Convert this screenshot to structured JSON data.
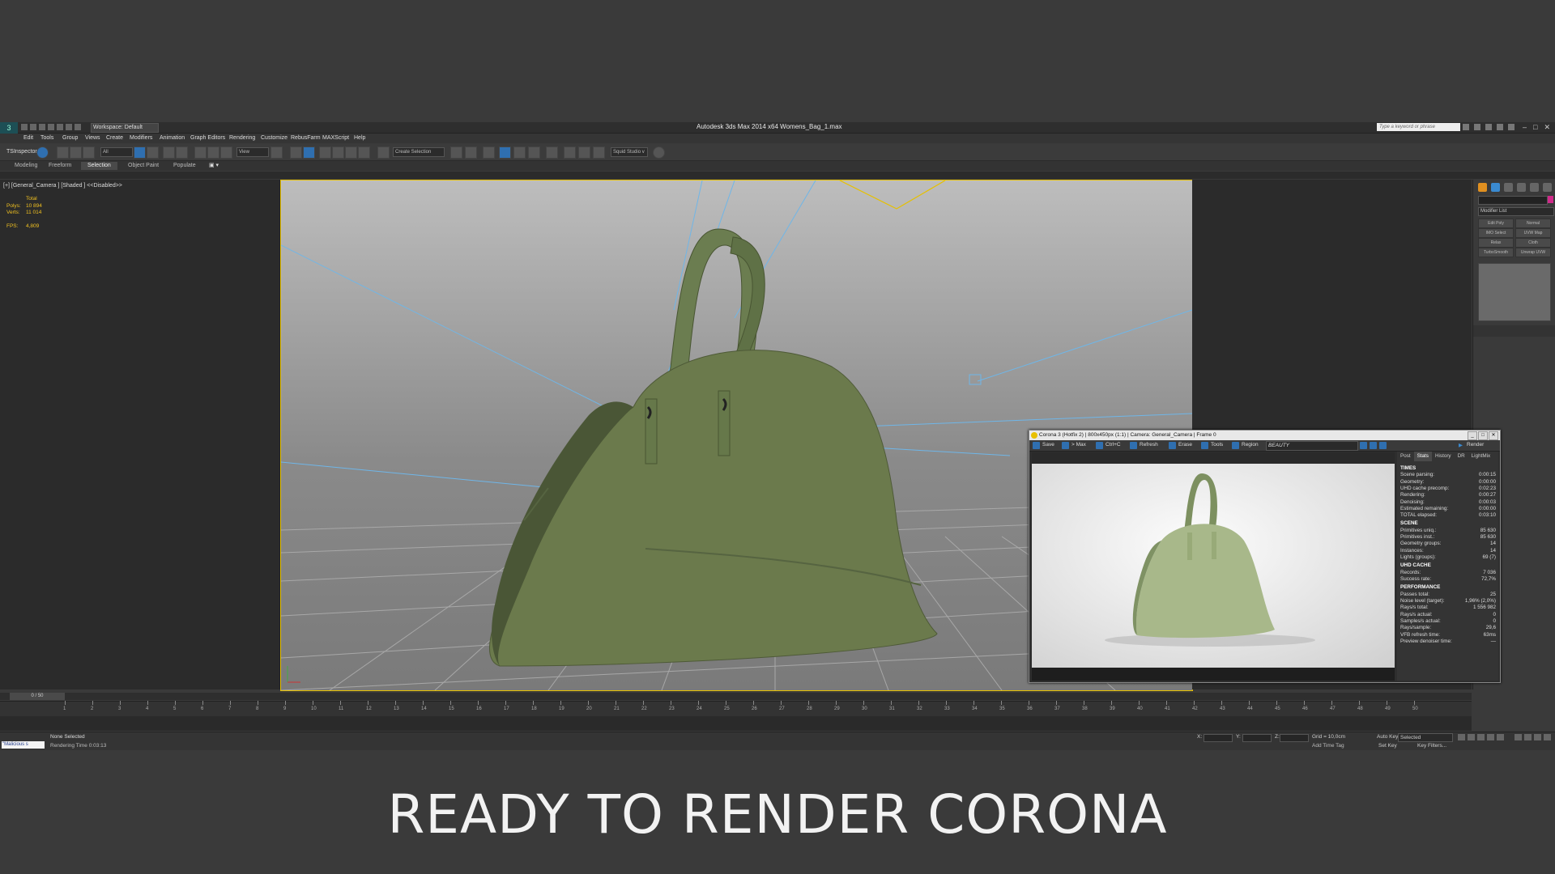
{
  "app": {
    "title": "Autodesk 3ds Max  2014 x64    Womens_Bag_1.max",
    "workspace": "Workspace: Default",
    "search_placeholder": "Type a keyword or phrase",
    "logo": "3"
  },
  "menu": [
    "Edit",
    "Tools",
    "Group",
    "Views",
    "Create",
    "Modifiers",
    "Animation",
    "Graph Editors",
    "Rendering",
    "Customize",
    "RebusFarm",
    "MAXScript",
    "Help"
  ],
  "toolbar": {
    "tsinspector": "TSInspector",
    "filter_all": "All",
    "ref_coord": "View",
    "named_selection": "Create Selection",
    "squid": "Squid Studio v"
  },
  "ribbon_tabs": [
    "Modeling",
    "Freeform",
    "Selection",
    "Object Paint",
    "Populate"
  ],
  "ribbon_active": "Selection",
  "viewport": {
    "label": "[+] [General_Camera ] [Shaded ]  <<Disabled>>",
    "stats_header": "Total",
    "polys_label": "Polys:",
    "polys": "10 894",
    "verts_label": "Verts:",
    "verts": "11 014",
    "fps_label": "FPS:",
    "fps": "4,809"
  },
  "command_panel": {
    "modifier_list": "Modifier List",
    "buttons": [
      "Edit Poly",
      "Normal",
      "IMO Select",
      "UVW Map",
      "Relax",
      "Cloth",
      "TurboSmooth",
      "Unwrap UVW"
    ]
  },
  "timeline": {
    "frame": "0 / 50",
    "ticks": [
      "1",
      "2",
      "3",
      "4",
      "5",
      "6",
      "7",
      "8",
      "9",
      "10",
      "11",
      "12",
      "13",
      "14",
      "15",
      "16",
      "17",
      "18",
      "19",
      "20",
      "21",
      "22",
      "23",
      "24",
      "25",
      "26",
      "27",
      "28",
      "29",
      "30",
      "31",
      "32",
      "33",
      "34",
      "35",
      "36",
      "37",
      "38",
      "39",
      "40",
      "41",
      "42",
      "43",
      "44",
      "45",
      "46",
      "47",
      "48",
      "49",
      "50"
    ]
  },
  "status": {
    "script": "\"Malicious s",
    "selection": "None Selected",
    "render_time": "Rendering Time  0:03:13",
    "x_label": "X:",
    "y_label": "Y:",
    "z_label": "Z:",
    "grid": "Grid = 10,0cm",
    "add_time_tag": "Add Time Tag",
    "auto_key": "Auto Key",
    "auto_key_mode": "Selected",
    "set_key": "Set Key",
    "key_filters": "Key Filters..."
  },
  "vfb": {
    "title": "Corona 3 (Hotfix 2) | 800x450px (1:1) | Camera: General_Camera | Frame 0",
    "tools": [
      "Save",
      "> Max",
      "Ctrl+C",
      "Refresh",
      "Erase",
      "Tools",
      "Region"
    ],
    "channel": "BEAUTY",
    "render": "Render",
    "tabs": [
      "Post",
      "Stats",
      "History",
      "DR",
      "LightMix"
    ],
    "active_tab": "Stats",
    "sections": [
      {
        "title": "TIMES",
        "rows": [
          [
            "Scene parsing:",
            "0:00:15"
          ],
          [
            "Geometry:",
            "0:00:00"
          ],
          [
            "UHD cache precomp:",
            "0:02:23"
          ],
          [
            "Rendering:",
            "0:00:27"
          ],
          [
            "Denoising:",
            "0:00:03"
          ],
          [
            "Estimated remaining:",
            "0:00:00"
          ],
          [
            "TOTAL elapsed:",
            "0:03:10"
          ]
        ]
      },
      {
        "title": "SCENE",
        "rows": [
          [
            "Primitives uniq.:",
            "85 630"
          ],
          [
            "Primitives inst.:",
            "85 630"
          ],
          [
            "Geometry groups:",
            "14"
          ],
          [
            "Instances:",
            "14"
          ],
          [
            "Lights (groups):",
            "69 (7)"
          ]
        ]
      },
      {
        "title": "UHD CACHE",
        "rows": [
          [
            "Records:",
            "7 036"
          ],
          [
            "Success rate:",
            "72,7%"
          ]
        ]
      },
      {
        "title": "PERFORMANCE",
        "rows": [
          [
            "Passes total:",
            "25"
          ],
          [
            "Noise level (target):",
            "1,96% (2,0%)"
          ],
          [
            "Rays/s total:",
            "1 556 982"
          ],
          [
            "Rays/s actual:",
            "0"
          ],
          [
            "Samples/s actual:",
            "0"
          ],
          [
            "Rays/sample:",
            "29,6"
          ],
          [
            "VFB refresh time:",
            "63ms"
          ],
          [
            "Preview denoiser time:",
            "—"
          ]
        ]
      }
    ]
  },
  "caption": "READY TO RENDER  CORONA"
}
